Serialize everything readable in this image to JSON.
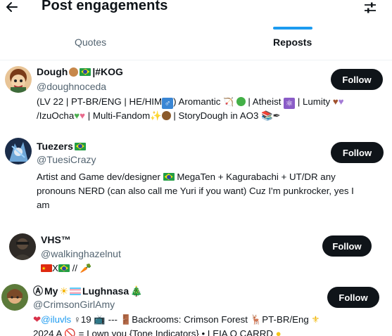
{
  "header": {
    "title": "Post engagements",
    "back_icon": "arrow-left-icon",
    "filter_icon": "sliders-icon"
  },
  "tabs": [
    {
      "label": "Quotes",
      "active": false
    },
    {
      "label": "Reposts",
      "active": true
    }
  ],
  "colors": {
    "accent": "#1d9bf0",
    "text": "#0f1419",
    "muted": "#536471",
    "button": "#0f1419"
  },
  "users": [
    {
      "display_name": "Dough",
      "name_suffix": "|#KOG",
      "handle": "@doughnoceda",
      "button": "Follow",
      "bio_parts": [
        "(LV 22 | PT-BR/ENG | HE/HIM",
        ") Aromantic",
        " | Atheist",
        " | Lumity",
        "/IzuOcha",
        " | Multi-Fandom",
        " | StoryDough in AO3"
      ]
    },
    {
      "display_name": "Tuezers",
      "handle": "@TuesiCrazy",
      "button": "Follow",
      "bio_line1_a": "Artist and Game dev/designer",
      "bio_line1_b": "MegaTen + Kagurabachi + UT/DR any",
      "bio_line2": "pronouns NERD (can also call me Yuri if you want) Cuz I'm punkrocker, yes I",
      "bio_line3": "am"
    },
    {
      "display_name": "VHS™",
      "handle": "@walkinghazelnut",
      "button": "Follow",
      "bio_x": "X",
      "bio_slash": " //"
    },
    {
      "display_name_a": "Ⓐ",
      "display_name_b": "My",
      "display_name_c": "Lughnasa",
      "handle": "@CrimsonGirlAmy",
      "button": "Follow",
      "bio_mention": "@iluvls",
      "bio_age": "19",
      "bio_mid": "---",
      "bio_after": "Backrooms: Crimson Forest",
      "bio_lang": "PT-BR/Eng",
      "bio_line2_a": "2024 A",
      "bio_line2_b": "= I own you {Tone Indicators} • LEIA O CARRD"
    }
  ]
}
